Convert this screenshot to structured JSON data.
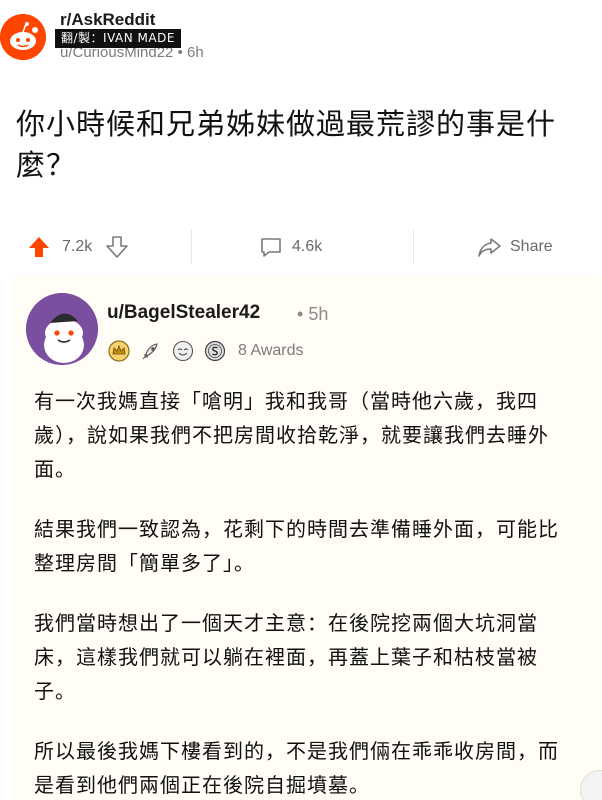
{
  "post": {
    "subreddit": "r/AskReddit",
    "author": "u/CuriousMind22",
    "age": "6h",
    "separator": "•",
    "watermark": "翻/製：IVAN MADE",
    "title": "你小時候和兄弟姊妹做過最荒謬的事是什麼？",
    "upvotes": "7.2k",
    "comments": "4.6k",
    "share_label": "Share"
  },
  "comment": {
    "username": "u/BagelStealer42",
    "separator": "•",
    "age": "5h",
    "awards_label": "8 Awards",
    "award_icons": [
      "crown-award-icon",
      "rocket-award-icon",
      "wholesome-award-icon",
      "silver-coin-award-icon"
    ],
    "paragraphs": [
      "有一次我媽直接「嗆明」我和我哥（當時他六歲，我四歲），說如果我們不把房間收拾乾淨，就要讓我們去睡外面。",
      "結果我們一致認為，花剩下的時間去準備睡外面，可能比整理房間「簡單多了」。",
      "我們當時想出了一個天才主意：在後院挖兩個大坑洞當床，這樣我們就可以躺在裡面，再蓋上葉子和枯枝當被子。",
      "所以最後我媽下樓看到的，不是我們倆在乖乖收房間，而是看到他們兩個正在後院自掘墳墓。"
    ]
  },
  "colors": {
    "upvote_accent": "#ff4500",
    "card_background": "#fffdf6",
    "meta_gray": "#7c7c7c",
    "avatar_purple": "#7b4fa0"
  }
}
